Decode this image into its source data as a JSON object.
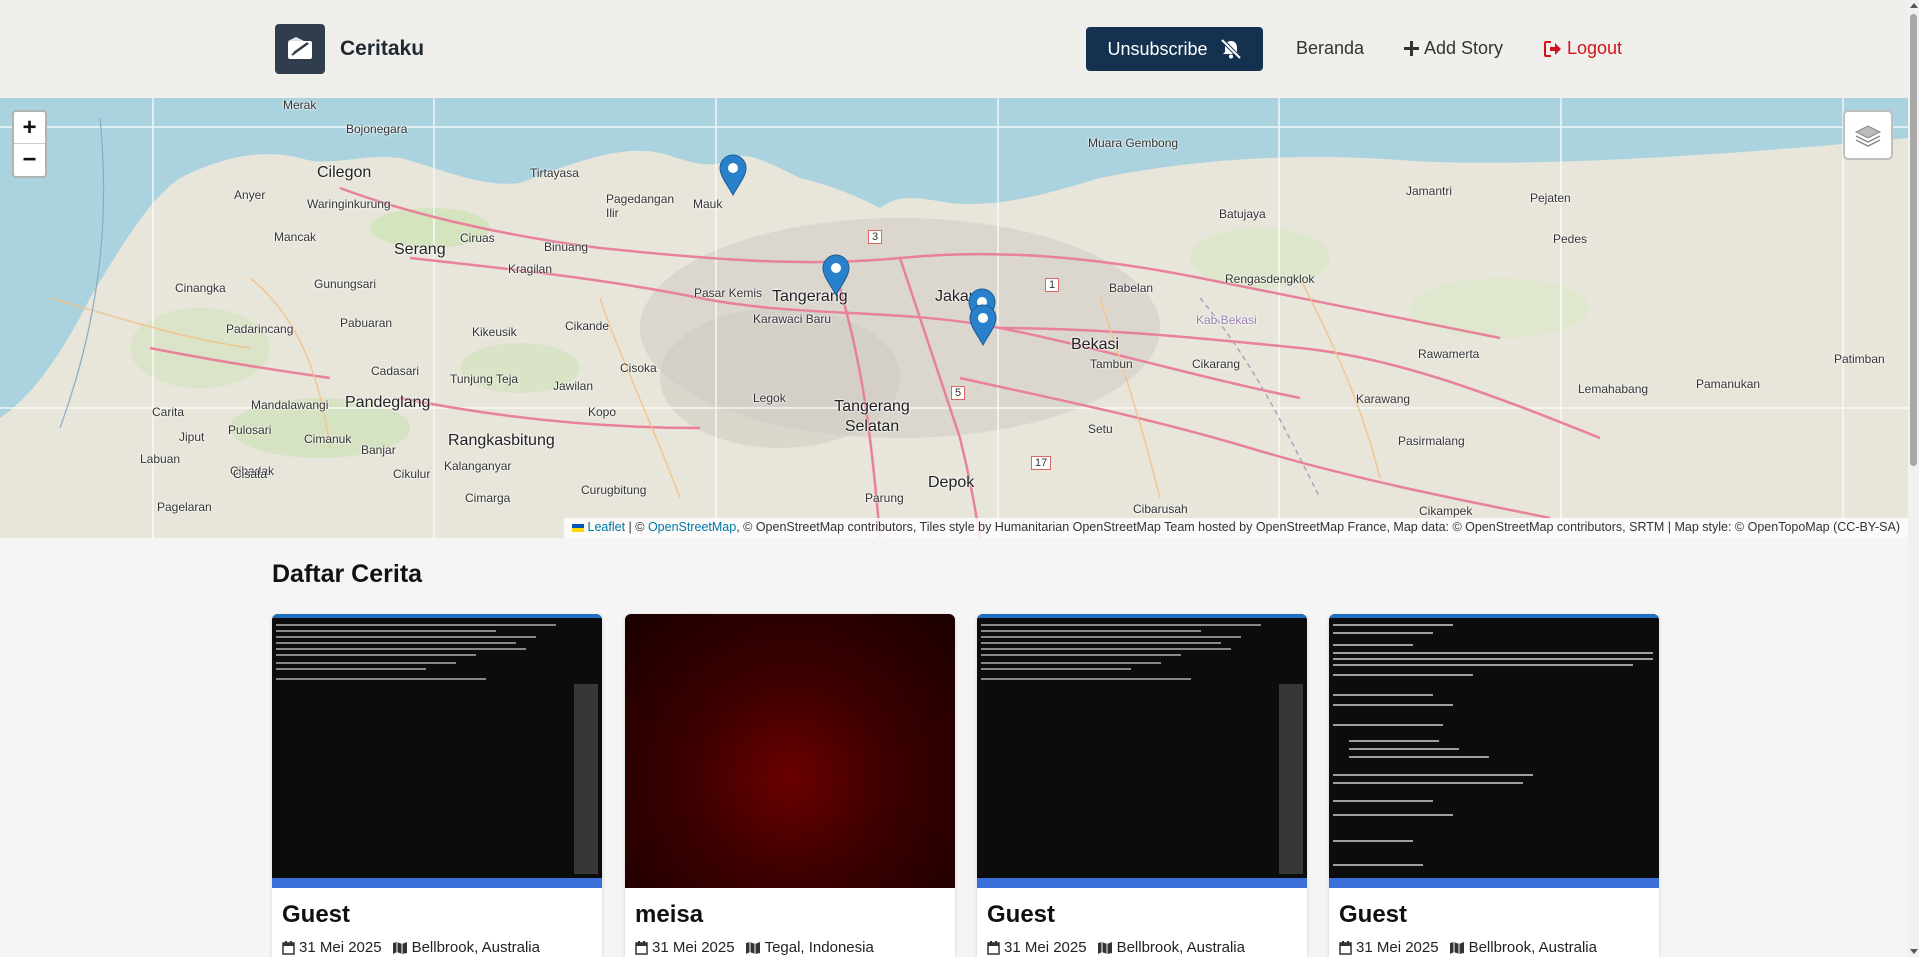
{
  "app": {
    "name": "Ceritaku"
  },
  "header": {
    "unsubscribe_label": "Unsubscribe",
    "nav": {
      "home": "Beranda",
      "add_story": "Add Story",
      "logout": "Logout"
    }
  },
  "map": {
    "zoom_in": "+",
    "zoom_out": "−",
    "attribution": {
      "leaflet": "Leaflet",
      "sep1": " | © ",
      "osm": "OpenStreetMap",
      "rest": ", © OpenStreetMap contributors, Tiles style by Humanitarian OpenStreetMap Team hosted by OpenStreetMap France, Map data: © OpenStreetMap contributors, SRTM | Map style: © OpenTopoMap (CC-BY-SA)"
    },
    "places": [
      "Merak",
      "Bojonegara",
      "Cilegon",
      "Anyer",
      "Waringinkurung",
      "Tirtayasa",
      "Pagedangan Ilir",
      "Mauk",
      "Muara Gembong",
      "Jamantri",
      "Pejaten",
      "Batujaya",
      "Pedes",
      "Serang",
      "Kragilan",
      "Binuang",
      "Mancak",
      "Cinangka",
      "Gunungsari",
      "Padarincang",
      "Pabuaran",
      "Ciruas",
      "Kikeusik",
      "Pasar Kemis",
      "Tangerang",
      "Karawaci Baru",
      "Jakarta",
      "Babelan",
      "Rengasdengklok",
      "Kab Bekasi",
      "Cikande",
      "Bekasi",
      "Tambun",
      "Cikarang",
      "Rawamerta",
      "Patimban",
      "Carita",
      "Cadasari",
      "Tunjung Teja",
      "Jawilan",
      "Cisoka",
      "Legok",
      "Tangerang Selatan",
      "Setu",
      "Karawang",
      "Lemahabang",
      "Pamanukan",
      "Mandalawangi",
      "Pandeglang",
      "Kopo",
      "Jiput",
      "Pulosari",
      "Cimanuk",
      "Rangkasbitung",
      "Labuan",
      "Banjar",
      "Cibadak",
      "Pasirmalang",
      "Cisata",
      "Cikulur",
      "Kalanganyar",
      "Curugbitung",
      "Depok",
      "Cimarga",
      "Parung",
      "Cibarusah",
      "Cikampek",
      "Pagelaran"
    ],
    "route_badges": [
      "3",
      "1",
      "5",
      "17"
    ]
  },
  "stories": {
    "title": "Daftar Cerita",
    "items": [
      {
        "name": "Guest",
        "date": "31 Mei 2025",
        "location": "Bellbrook, Australia",
        "image": "terminal-screenshot"
      },
      {
        "name": "meisa",
        "date": "31 Mei 2025",
        "location": "Tegal, Indonesia",
        "image": "dark-red-photo"
      },
      {
        "name": "Guest",
        "date": "31 Mei 2025",
        "location": "Bellbrook, Australia",
        "image": "terminal-screenshot"
      },
      {
        "name": "Guest",
        "date": "31 Mei 2025",
        "location": "Bellbrook, Australia",
        "image": "terminal-screenshot"
      }
    ]
  },
  "colors": {
    "primary": "#14324f",
    "logout": "#d0121c",
    "sea": "#aad3df",
    "marker": "#2a81cb"
  },
  "icons": {
    "unsubscribe": "bell-slash-icon",
    "add": "plus-icon",
    "logout": "sign-out-icon",
    "calendar": "calendar-icon",
    "map": "map-icon",
    "layers": "layers-icon"
  }
}
